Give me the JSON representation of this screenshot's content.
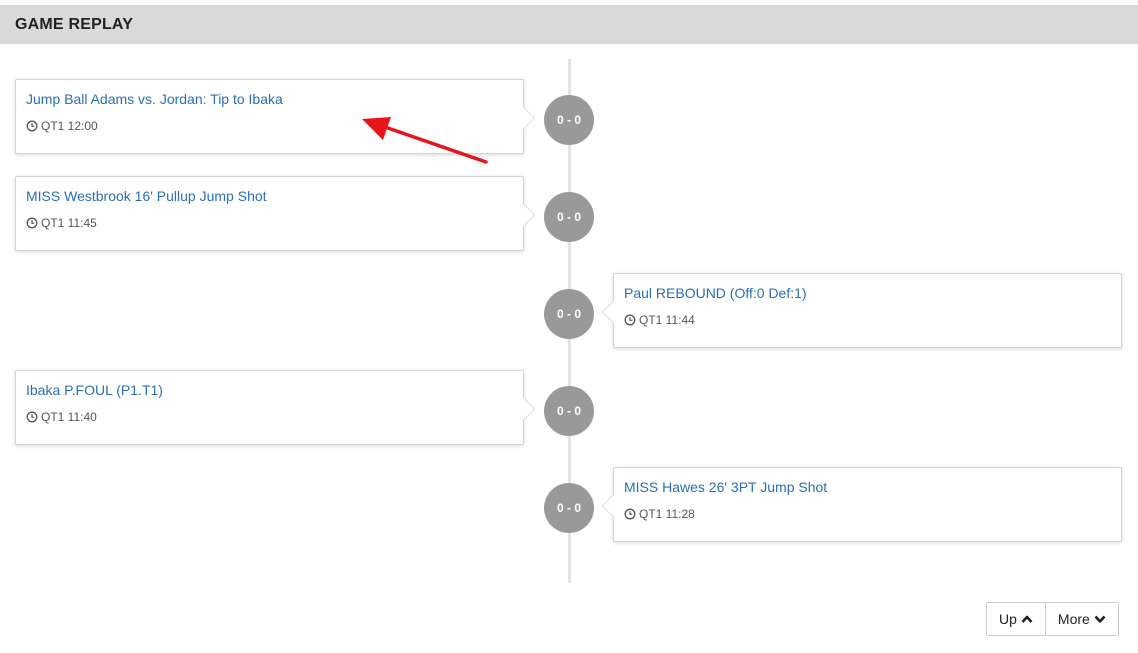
{
  "header": {
    "title": "GAME REPLAY"
  },
  "events": [
    {
      "side": "left",
      "title": "Jump Ball Adams vs. Jordan: Tip to Ibaka",
      "time": "QT1 12:00",
      "score": "0 - 0"
    },
    {
      "side": "left",
      "title": "MISS Westbrook 16' Pullup Jump Shot",
      "time": "QT1 11:45",
      "score": "0 - 0"
    },
    {
      "side": "right",
      "title": "Paul REBOUND (Off:0 Def:1)",
      "time": "QT1 11:44",
      "score": "0 - 0"
    },
    {
      "side": "left",
      "title": "Ibaka P.FOUL (P1.T1)",
      "time": "QT1 11:40",
      "score": "0 - 0"
    },
    {
      "side": "right",
      "title": "MISS Hawes 26' 3PT Jump Shot",
      "time": "QT1 11:28",
      "score": "0 - 0"
    }
  ],
  "pager": {
    "up_label": "Up",
    "more_label": "More"
  },
  "icons": {
    "time": "clock-icon",
    "up": "chevron-up-icon",
    "more": "chevron-down-icon"
  },
  "colors": {
    "link": "#2a6fb4",
    "badge": "#999999",
    "header_bg": "#d9d9d9",
    "annotation": "#e8141b"
  }
}
